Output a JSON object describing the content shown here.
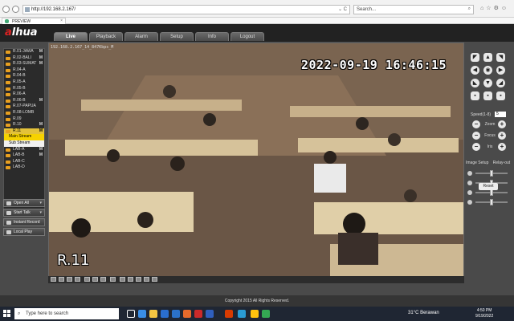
{
  "browser": {
    "address": "http://192.168.2.167/",
    "address_controls": "⌄ C",
    "search_placeholder": "Search...",
    "tab_title": "PREVIEW",
    "tab_close": "×"
  },
  "app": {
    "logo_a": "a",
    "logo_rest": "lhua",
    "tabs": [
      {
        "label": "Live"
      },
      {
        "label": "Playback"
      },
      {
        "label": "Alarm"
      },
      {
        "label": "Setup"
      },
      {
        "label": "Info"
      },
      {
        "label": "Logout"
      }
    ],
    "active_tab": "Live"
  },
  "channels": [
    {
      "label": "R.01-JAWA",
      "m": "M"
    },
    {
      "label": "R.02-BALI",
      "m": "M"
    },
    {
      "label": "R.03-SUMAT",
      "m": "M"
    },
    {
      "label": "R.04-A",
      "m": ""
    },
    {
      "label": "R.04-B",
      "m": ""
    },
    {
      "label": "R.05-A",
      "m": ""
    },
    {
      "label": "R.05-B",
      "m": ""
    },
    {
      "label": "R.06-A",
      "m": ""
    },
    {
      "label": "R.06-B",
      "m": "M"
    },
    {
      "label": "R.07-PAPUA",
      "m": ""
    },
    {
      "label": "R.08-LOMB",
      "m": ""
    },
    {
      "label": "R.09",
      "m": ""
    },
    {
      "label": "R.10",
      "m": "M"
    },
    {
      "label": "R.11",
      "m": "M"
    }
  ],
  "streams": {
    "main": "Main Stream",
    "sub": "Sub Stream"
  },
  "channels_after": [
    {
      "label": "LAB-A",
      "m": "M"
    },
    {
      "label": "LAB-B",
      "m": "M"
    },
    {
      "label": "LAB-C",
      "m": ""
    },
    {
      "label": "LAB-D",
      "m": ""
    }
  ],
  "left_buttons": [
    {
      "label": "Open All",
      "dd": "▾"
    },
    {
      "label": "Start Talk",
      "dd": "▾"
    },
    {
      "label": "Instant Record",
      "dd": ""
    },
    {
      "label": "Local Play",
      "dd": ""
    }
  ],
  "video": {
    "info": "192.168.2.167_14_847Kbps_M",
    "timestamp": "2022-09-19 16:46:15",
    "channel_name": "R.11"
  },
  "ptz": {
    "speed_label": "Speed(1-8)",
    "speed_value": "5",
    "zoom_label": "Zoom",
    "focus_label": "Focus",
    "iris_label": "Iris",
    "plus": "+",
    "minus": "−"
  },
  "image_setup": {
    "title": "Image Setup",
    "relay": "Relay-out",
    "reset": "Reset",
    "sliders": [
      0.5,
      0.5,
      0.5,
      0.5
    ]
  },
  "footer": {
    "copyright": "Copyright 2015 All Rights Reserved."
  },
  "taskbar": {
    "search_placeholder": "Type here to search",
    "weather": "31°C  Berawan",
    "time": "4:50 PM",
    "date": "9/19/2022"
  }
}
